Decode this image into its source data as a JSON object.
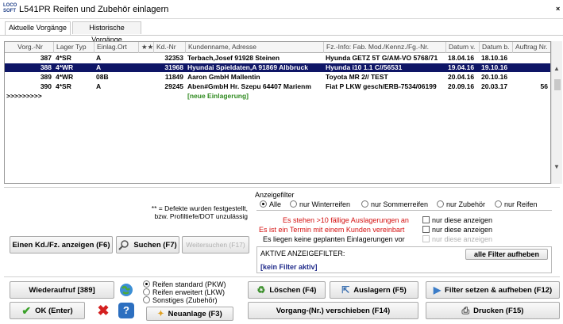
{
  "window": {
    "logo_text": "LOCO SOFT",
    "title": "L541PR Reifen und Zubehör einlagern",
    "close_glyph": "×"
  },
  "tabs": [
    {
      "label": "Aktuelle Vorgänge",
      "active": true
    },
    {
      "label": "Historische Vorgänge",
      "active": false
    }
  ],
  "table": {
    "columns": [
      "Vorg.-Nr",
      "Lager Typ",
      "Einlag.Ort",
      "★★",
      "Kd.-Nr",
      "Kundenname, Adresse",
      "Fz.-Info: Fab. Mod./Kennz./Fg.-Nr.",
      "Datum v.",
      "Datum b.",
      "Auftrag Nr."
    ],
    "rows": [
      {
        "vorg": "387",
        "typ": "4*SR",
        "ort": "A",
        "stars": "",
        "kd": "32353",
        "name": "Terbach,Josef 91928 Steinen",
        "fz": "Hyunda GETZ 5T G/AM-VO 5768/71",
        "datum_v": "18.04.16",
        "datum_b": "18.10.16",
        "auftrag": "",
        "selected": false
      },
      {
        "vorg": "388",
        "typ": "4*WR",
        "ort": "A",
        "stars": "",
        "kd": "31968",
        "name": "Hyundai Spieldaten,A 91869 Albbruck",
        "fz": "Hyunda i10 1.1 C//56531",
        "datum_v": "19.04.16",
        "datum_b": "19.10.16",
        "auftrag": "",
        "selected": true
      },
      {
        "vorg": "389",
        "typ": "4*WR",
        "ort": "08B",
        "stars": "",
        "kd": "11849",
        "name": "Aaron GmbH Mallentin",
        "fz": "Toyota MR 2// TEST",
        "datum_v": "20.04.16",
        "datum_b": "20.10.16",
        "auftrag": "",
        "selected": false
      },
      {
        "vorg": "390",
        "typ": "4*SR",
        "ort": "A",
        "stars": "",
        "kd": "29245",
        "name": "Aben#GmbH Hr. Szepu 64407 Marienm",
        "fz": "Fiat P LKW gesch/ERB-7534/06199",
        "datum_v": "20.09.16",
        "datum_b": "20.03.17",
        "auftrag": "56",
        "selected": false
      }
    ],
    "new_row_marker": ">>>>>>>>>",
    "new_row_label": "[neue Einlagerung]"
  },
  "scrollbar": {
    "up": "▲",
    "down": "▼"
  },
  "hint": {
    "line1": "** = Defekte wurden festgestellt,",
    "line2": "bzw. Profiltiefe/DOT unzulässig"
  },
  "filter": {
    "heading": "Anzeigefilter",
    "options": [
      "Alle",
      "nur Winterreifen",
      "nur Sommerreifen",
      "nur Zubehör",
      "nur Reifen"
    ],
    "selected_index": 0,
    "line1": "Es stehen >10 fällige Auslagerungen an",
    "line2": "Es ist ein Termin mit einem Kunden vereinbart",
    "line3": "Es liegen keine geplanten Einlagerungen vor",
    "only_these": "nur diese anzeigen",
    "active_label": "AKTIVE ANZEIGEFILTER:",
    "active_value": "[kein Filter aktiv]",
    "reset_button": "alle Filter aufheben"
  },
  "buttons": {
    "show_customer": "Einen Kd./Fz. anzeigen (F6)",
    "search": "Suchen (F7)",
    "search_next": "Weitersuchen (F17)",
    "recall": "Wiederaufruf [389]",
    "ok": "OK (Enter)",
    "delete": "Löschen (F4)",
    "retrieve": "Auslagern (F5)",
    "set_filter": "Filter setzen & aufheben (F12)",
    "move": "Vorgang-(Nr.) verschieben (F14)",
    "print": "Drucken (F15)",
    "new": "Neuanlage (F3)"
  },
  "tire_options": {
    "options": [
      "Reifen standard (PKW)",
      "Reifen erweitert (LKW)",
      "Sonstiges (Zubehör)"
    ],
    "selected_index": 0
  },
  "colors": {
    "selection": "#0e1566",
    "alert_red": "#d41010",
    "new_entry_green": "#2f8a1f"
  }
}
